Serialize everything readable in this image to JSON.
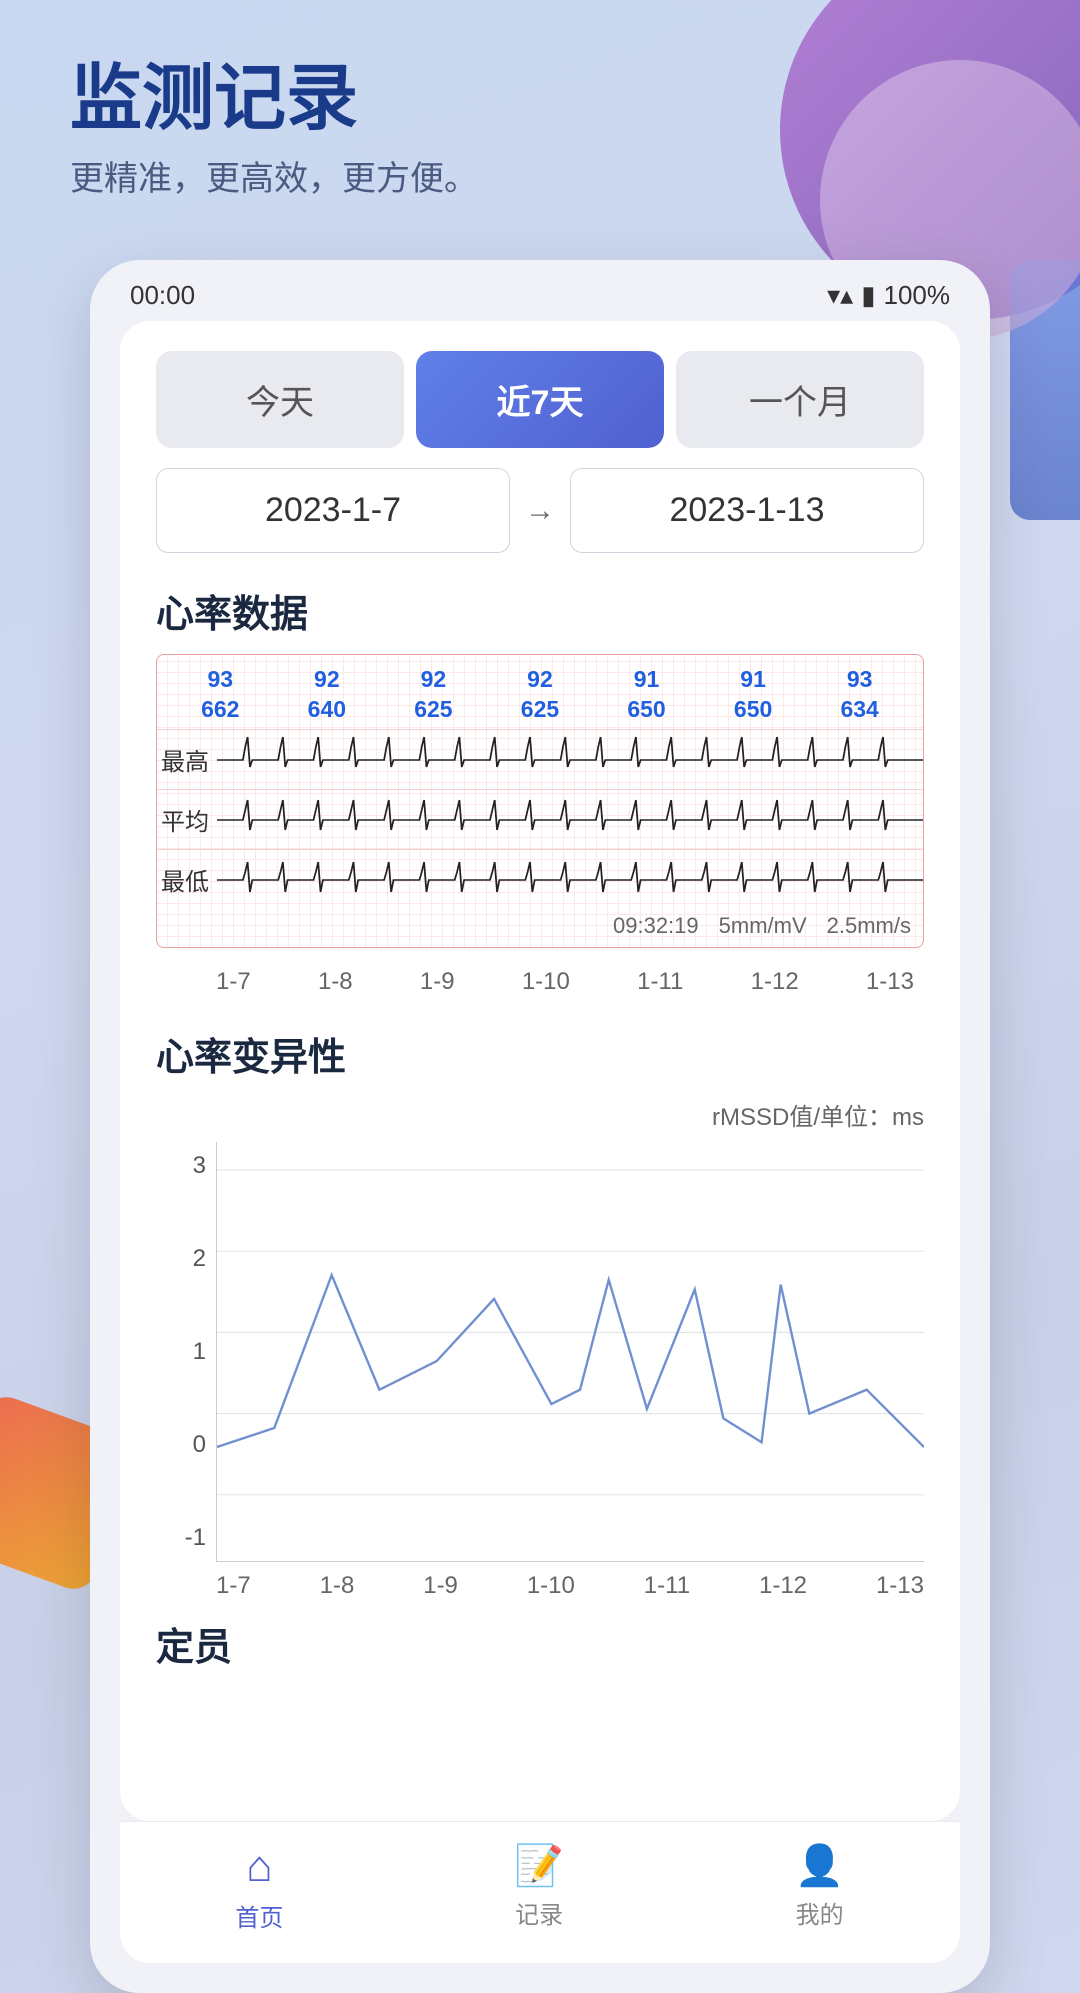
{
  "status_bar": {
    "time": "00:00",
    "wifi": "▲",
    "battery": "100%"
  },
  "header": {
    "title": "监测记录",
    "subtitle": "更精准，更高效，更方便。"
  },
  "tabs": [
    {
      "id": "today",
      "label": "今天",
      "active": false
    },
    {
      "id": "week7",
      "label": "近7天",
      "active": true
    },
    {
      "id": "month",
      "label": "一个月",
      "active": false
    }
  ],
  "date_range": {
    "start": "2023-1-7",
    "arrow": "→",
    "end": "2023-1-13"
  },
  "heart_rate_section": {
    "title": "心率数据",
    "ecg_data": [
      {
        "top": "93",
        "bottom": "662"
      },
      {
        "top": "92",
        "bottom": "640"
      },
      {
        "top": "92",
        "bottom": "625"
      },
      {
        "top": "92",
        "bottom": "625"
      },
      {
        "top": "91",
        "bottom": "650"
      },
      {
        "top": "91",
        "bottom": "650"
      },
      {
        "top": "93",
        "bottom": "634"
      }
    ],
    "row_labels": [
      "最高",
      "平均",
      "最低"
    ],
    "bottom_info": [
      "09:32:19",
      "5mm/mV",
      "2.5mm/s"
    ],
    "x_axis": [
      "1-7",
      "1-8",
      "1-9",
      "1-10",
      "1-11",
      "1-12",
      "1-13"
    ]
  },
  "hrv_section": {
    "title": "心率变异性",
    "unit_label": "rMSSD值/单位：ms",
    "y_axis": [
      "3",
      "2",
      "1",
      "0",
      "-1"
    ],
    "x_axis": [
      "1-7",
      "1-8",
      "1-9",
      "1-10",
      "1-11",
      "1-12",
      "1-13"
    ]
  },
  "partial_section": {
    "title": "定员"
  },
  "bottom_nav": [
    {
      "id": "home",
      "label": "首页",
      "active": true,
      "icon": "⌂"
    },
    {
      "id": "records",
      "label": "记录",
      "active": false,
      "icon": "📋"
    },
    {
      "id": "mine",
      "label": "我的",
      "active": false,
      "icon": "👤"
    }
  ]
}
